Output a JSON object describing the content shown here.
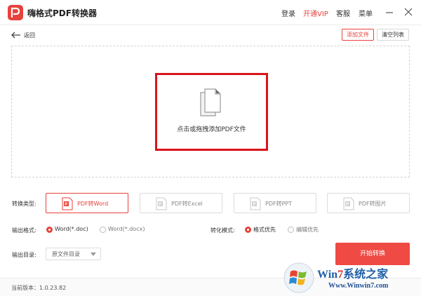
{
  "app": {
    "title": "嗨格式PDF转换器",
    "accent": "#e8423c"
  },
  "titlebar": {
    "login": "登录",
    "vip": "开通VIP",
    "service": "客服",
    "menu": "菜单",
    "icons": [
      "minimize-icon",
      "close-icon"
    ]
  },
  "toolbar": {
    "back": "返回",
    "add_file": "添加文件",
    "clear_list": "清空列表"
  },
  "dropzone": {
    "label": "点击或拖拽添加PDF文件",
    "icon": "document-stack-icon"
  },
  "convert_type": {
    "label": "转换类型:",
    "options": [
      {
        "label": "PDF转Word",
        "active": true
      },
      {
        "label": "PDF转Excel",
        "active": false
      },
      {
        "label": "PDF转PPT",
        "active": false
      },
      {
        "label": "PDF转图片",
        "active": false
      }
    ]
  },
  "output_format": {
    "label": "输出格式:",
    "options": [
      {
        "label": "Word(*.doc)",
        "selected": true
      },
      {
        "label": "Word(*.docx)",
        "selected": false
      }
    ]
  },
  "convert_mode": {
    "label": "转化模式:",
    "options": [
      {
        "label": "格式优先",
        "selected": true
      },
      {
        "label": "编辑优先",
        "selected": false
      }
    ]
  },
  "output_dir": {
    "label": "输出目录:",
    "value": "原文件目录"
  },
  "start_button": "开始转换",
  "footer": {
    "version": "当前版本：1.0.23.82"
  },
  "watermark": {
    "title_prefix": "Win",
    "title_seven": "7",
    "title_suffix": "系统之家",
    "url": "Www.Winwin7.com"
  }
}
